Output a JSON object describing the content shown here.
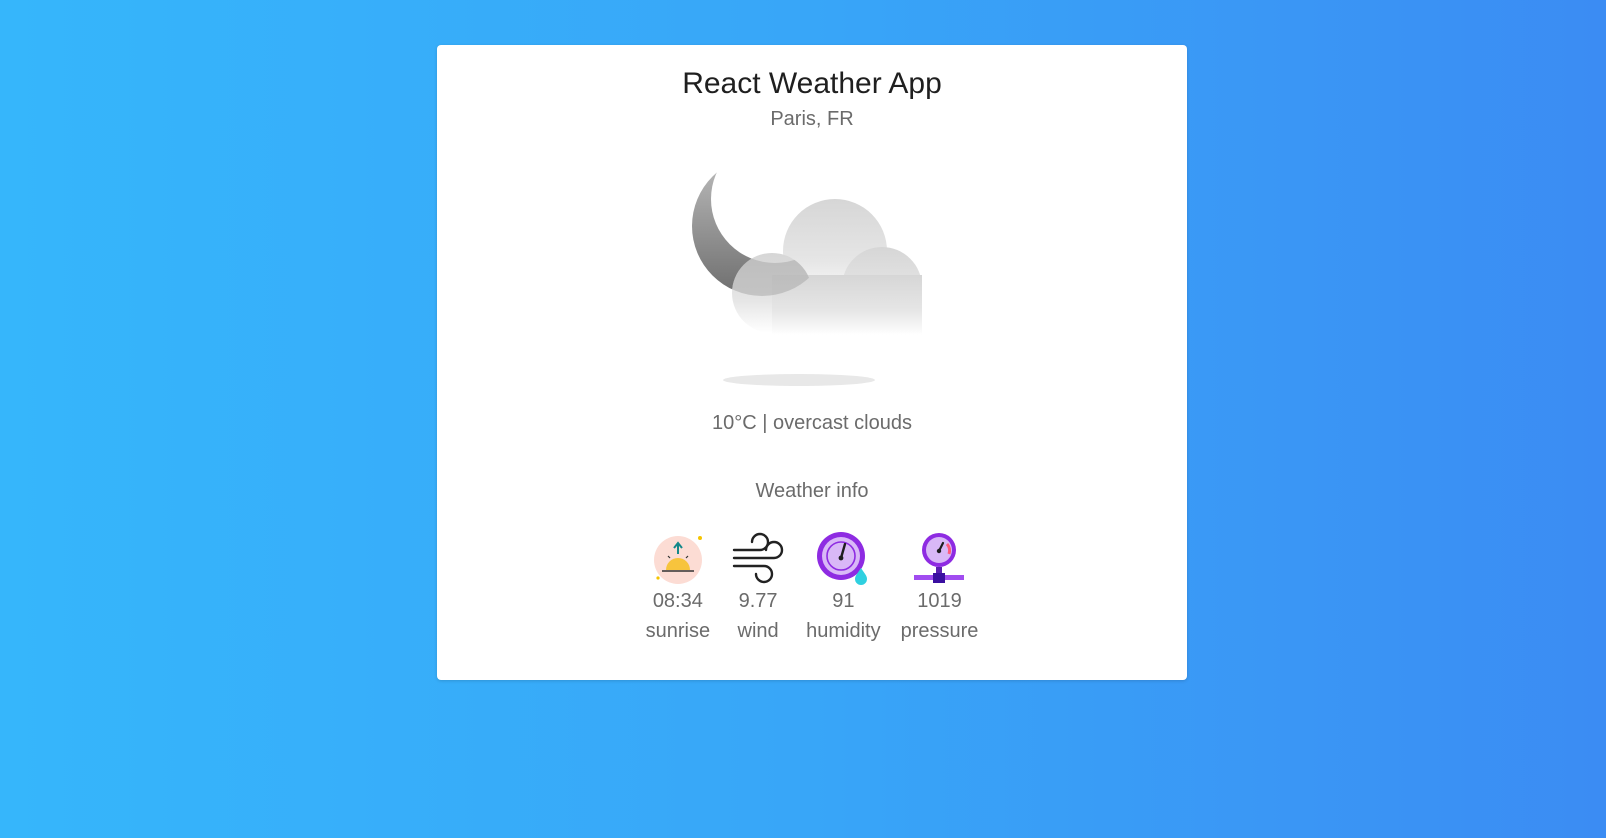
{
  "app": {
    "title": "React Weather App",
    "location": "Paris, FR"
  },
  "current": {
    "summary": "10°C | overcast clouds",
    "icon": "moon-cloud-icon"
  },
  "info": {
    "section_title": "Weather info",
    "items": [
      {
        "value": "08:34",
        "label": "sunrise",
        "icon": "sunrise-icon"
      },
      {
        "value": "9.77",
        "label": "wind",
        "icon": "wind-icon"
      },
      {
        "value": "91",
        "label": "humidity",
        "icon": "humidity-icon"
      },
      {
        "value": "1019",
        "label": "pressure",
        "icon": "pressure-icon"
      }
    ]
  },
  "colors": {
    "background_start": "#36b6fb",
    "background_end": "#3b8cf3",
    "card": "#ffffff",
    "text": "#6b6b6b",
    "title": "#1f1f1f"
  }
}
